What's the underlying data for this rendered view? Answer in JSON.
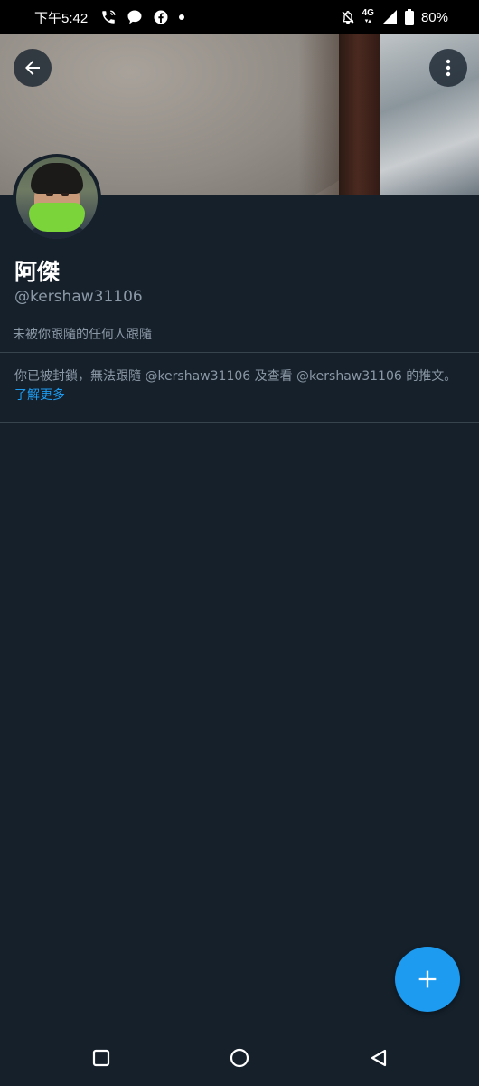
{
  "status_bar": {
    "time": "下午5:42",
    "network": "4G",
    "battery": "80%",
    "left_icons": [
      "call-icon",
      "chat-bubble-icon",
      "facebook-icon",
      "dot-icon"
    ],
    "right_icons": [
      "notifications-off-icon",
      "network-4g-icon",
      "signal-icon",
      "battery-icon"
    ]
  },
  "header": {
    "back_icon": "arrow-left-icon",
    "more_icon": "more-vertical-icon"
  },
  "profile": {
    "name": "阿傑",
    "handle": "@kershaw31106",
    "follow_note": "未被你跟隨的任何人跟隨"
  },
  "blocked": {
    "message": "你已被封鎖，無法跟隨 @kershaw31106 及查看 @kershaw31106 的推文。",
    "learn_more": "了解更多"
  },
  "fab": {
    "icon": "plus-icon",
    "color": "#1d9bf0"
  },
  "nav_bar": {
    "icons": [
      "recent-apps-icon",
      "home-icon",
      "back-icon"
    ]
  },
  "colors": {
    "background": "#15202b",
    "secondary_text": "#8b98a5",
    "accent": "#1d9bf0",
    "divider": "#38444d"
  }
}
